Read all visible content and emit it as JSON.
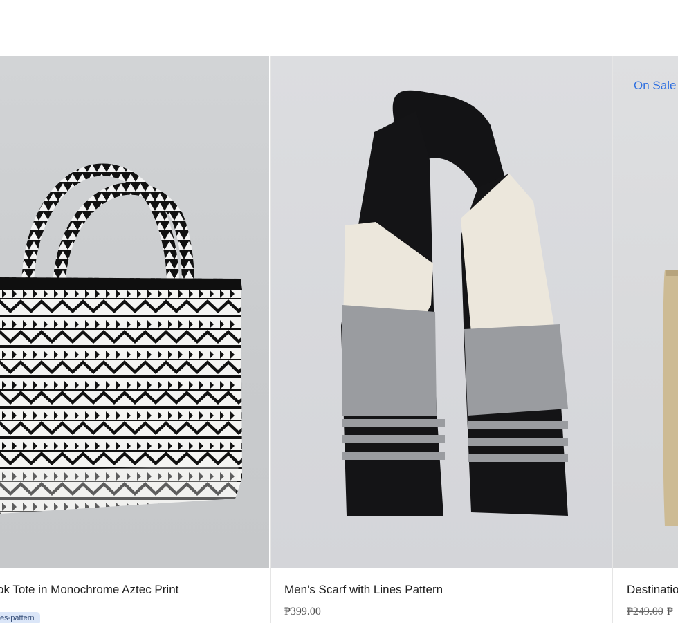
{
  "products": [
    {
      "name": "Book Tote in Monochrome Aztec Print",
      "visible_name": "ok Tote in Monochrome Aztec Print",
      "tag": "es-pattern"
    },
    {
      "name": "Men's Scarf with Lines Pattern",
      "price": "₱399.00"
    },
    {
      "name_visible": "Destinatio",
      "sale_label": "On Sale",
      "old_price": "₱249.00",
      "new_price_visible": "₱"
    }
  ],
  "colors": {
    "sale_accent": "#2f6fe0",
    "tag_bg": "#dbe6f8",
    "scarf_black": "#141416",
    "scarf_cream": "#ece7dc",
    "scarf_gray": "#9a9ca0",
    "tote_black": "#111111",
    "jute": "#cdbb94"
  },
  "icons": [
    "tote-bag-image",
    "scarf-image",
    "jute-bag-image"
  ]
}
